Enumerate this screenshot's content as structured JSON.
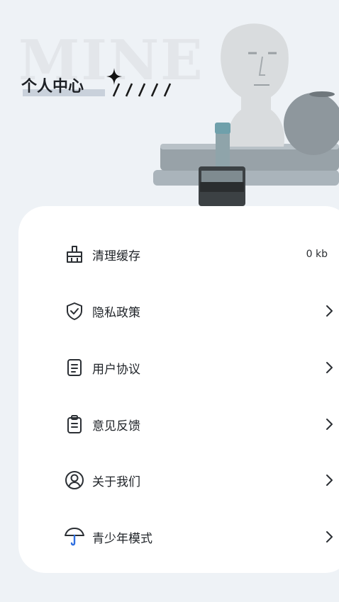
{
  "hero": {
    "bg_word": "MINE",
    "title": "个人中心"
  },
  "menu": [
    {
      "label": "清理缓存",
      "value": "0 kb",
      "icon": "broom-icon",
      "has_chevron": false
    },
    {
      "label": "隐私政策",
      "icon": "shield-check-icon",
      "has_chevron": true
    },
    {
      "label": "用户协议",
      "icon": "document-icon",
      "has_chevron": true
    },
    {
      "label": "意见反馈",
      "icon": "clipboard-icon",
      "has_chevron": true
    },
    {
      "label": "关于我们",
      "icon": "user-circle-icon",
      "has_chevron": true
    },
    {
      "label": "青少年模式",
      "icon": "umbrella-icon",
      "has_chevron": true
    }
  ],
  "colors": {
    "background": "#eef2f6",
    "card": "#ffffff",
    "icon_stroke": "#2b2f34",
    "umbrella_accent": "#2f6fe0"
  }
}
